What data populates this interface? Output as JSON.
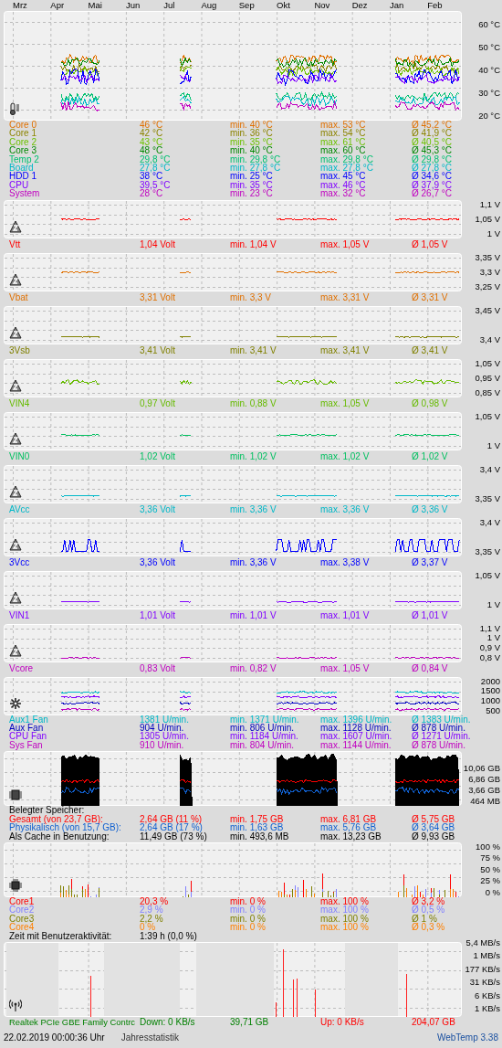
{
  "months": [
    "Mrz",
    "Apr",
    "Mai",
    "Jun",
    "Jul",
    "Aug",
    "Sep",
    "Okt",
    "Nov",
    "Dez",
    "Jan",
    "Feb"
  ],
  "panels": [
    {
      "kind": "temperature",
      "y_ticks": [
        "60 °C",
        "50 °C",
        "40 °C",
        "30 °C",
        "20 °C"
      ],
      "sensors": [
        {
          "name": "Core 0",
          "current": "46 °C",
          "min": "min. 40 °C",
          "max": "max. 53 °C",
          "avg": "Ø 45,2 °C",
          "color": "#e07000"
        },
        {
          "name": "Core 1",
          "current": "42 °C",
          "min": "min. 36 °C",
          "max": "max. 54 °C",
          "avg": "Ø 41,9 °C",
          "color": "#8c8400"
        },
        {
          "name": "Core 2",
          "current": "43 °C",
          "min": "min. 35 °C",
          "max": "max. 61 °C",
          "avg": "Ø 40,5 °C",
          "color": "#6cc000"
        },
        {
          "name": "Core 3",
          "current": "48 °C",
          "min": "min. 40 °C",
          "max": "max. 60 °C",
          "avg": "Ø 45,3 °C",
          "color": "#008800"
        },
        {
          "name": "Temp 2",
          "current": "29,8 °C",
          "min": "min. 29,8 °C",
          "max": "max. 29,8 °C",
          "avg": "Ø 29,8 °C",
          "color": "#00c070"
        },
        {
          "name": "Board",
          "current": "27,8 °C",
          "min": "min. 27,8 °C",
          "max": "max. 27,8 °C",
          "avg": "Ø 27,8 °C",
          "color": "#00b8c8"
        },
        {
          "name": "HDD 1",
          "current": "38 °C",
          "min": "min. 25 °C",
          "max": "max. 45 °C",
          "avg": "Ø 34,6 °C",
          "color": "#0000ff"
        },
        {
          "name": "CPU",
          "current": "39,5 °C",
          "min": "min. 35 °C",
          "max": "max. 46 °C",
          "avg": "Ø 37,9 °C",
          "color": "#8000ff"
        },
        {
          "name": "System",
          "current": "28 °C",
          "min": "min. 23 °C",
          "max": "max. 32 °C",
          "avg": "Ø 26,7 °C",
          "color": "#c000c0"
        }
      ]
    },
    {
      "kind": "voltage",
      "y_ticks": [
        "1,1 V",
        "1,05 V",
        "1 V"
      ],
      "sensors": [
        {
          "name": "Vtt",
          "current": "1,04 Volt",
          "min": "min. 1,04 V",
          "max": "max. 1,05 V",
          "avg": "Ø 1,05 V",
          "color": "#ff0000"
        }
      ]
    },
    {
      "kind": "voltage",
      "y_ticks": [
        "3,35 V",
        "3,3 V",
        "3,25 V"
      ],
      "sensors": [
        {
          "name": "Vbat",
          "current": "3,31 Volt",
          "min": "min. 3,3 V",
          "max": "max. 3,31 V",
          "avg": "Ø 3,31 V",
          "color": "#e07000"
        }
      ]
    },
    {
      "kind": "voltage",
      "y_ticks": [
        "3,45 V",
        "3,4 V"
      ],
      "sensors": [
        {
          "name": "3Vsb",
          "current": "3,41 Volt",
          "min": "min. 3,41 V",
          "max": "max. 3,41 V",
          "avg": "Ø 3,41 V",
          "color": "#808000"
        }
      ]
    },
    {
      "kind": "voltage",
      "y_ticks": [
        "1,05 V",
        "0,95 V",
        "0,85 V"
      ],
      "sensors": [
        {
          "name": "VIN4",
          "current": "0,97 Volt",
          "min": "min. 0,88 V",
          "max": "max. 1,05 V",
          "avg": "Ø 0,98 V",
          "color": "#66bb00"
        }
      ]
    },
    {
      "kind": "voltage",
      "y_ticks": [
        "1,05 V",
        "1 V"
      ],
      "sensors": [
        {
          "name": "VIN0",
          "current": "1,02 Volt",
          "min": "min. 1,02 V",
          "max": "max. 1,02 V",
          "avg": "Ø 1,02 V",
          "color": "#00c060"
        }
      ]
    },
    {
      "kind": "voltage",
      "y_ticks": [
        "3,4 V",
        "3,35 V"
      ],
      "sensors": [
        {
          "name": "AVcc",
          "current": "3,36 Volt",
          "min": "min. 3,36 V",
          "max": "max. 3,36 V",
          "avg": "Ø 3,36 V",
          "color": "#00b8c8"
        }
      ]
    },
    {
      "kind": "voltage",
      "y_ticks": [
        "3,4 V",
        "3,35 V"
      ],
      "sensors": [
        {
          "name": "3Vcc",
          "current": "3,36 Volt",
          "min": "min. 3,36 V",
          "max": "max. 3,38 V",
          "avg": "Ø 3,37 V",
          "color": "#0000ff"
        }
      ]
    },
    {
      "kind": "voltage",
      "y_ticks": [
        "1,05 V",
        "1 V"
      ],
      "sensors": [
        {
          "name": "VIN1",
          "current": "1,01 Volt",
          "min": "min. 1,01 V",
          "max": "max. 1,01 V",
          "avg": "Ø 1,01 V",
          "color": "#8000ff"
        }
      ]
    },
    {
      "kind": "voltage",
      "y_ticks": [
        "1,1 V",
        "1 V",
        "0,9 V",
        "0,8 V"
      ],
      "sensors": [
        {
          "name": "Vcore",
          "current": "0,83 Volt",
          "min": "min. 0,82 V",
          "max": "max. 1,05 V",
          "avg": "Ø 0,84 V",
          "color": "#c000c0"
        }
      ]
    },
    {
      "kind": "fan",
      "y_ticks": [
        "2000",
        "1500",
        "1000",
        "500"
      ],
      "sensors": [
        {
          "name": "Aux1 Fan",
          "current": "1381 U/min.",
          "min": "min. 1371 U/min.",
          "max": "max. 1396 U/min.",
          "avg": "Ø 1383 U/min.",
          "color": "#00b8c8"
        },
        {
          "name": "Aux Fan",
          "current": "904 U/min.",
          "min": "min. 806 U/min.",
          "max": "max. 1128 U/min.",
          "avg": "Ø 878 U/min.",
          "color": "#0000c0"
        },
        {
          "name": "CPU Fan",
          "current": "1305 U/min.",
          "min": "min. 1184 U/min.",
          "max": "max. 1607 U/min.",
          "avg": "Ø 1271 U/min.",
          "color": "#8000ff"
        },
        {
          "name": "Sys Fan",
          "current": "910 U/min.",
          "min": "min. 804 U/min.",
          "max": "max. 1144 U/min.",
          "avg": "Ø 878 U/min.",
          "color": "#c000c0"
        }
      ]
    },
    {
      "kind": "memory",
      "y_ticks": [
        "10,06 GB",
        "6,86 GB",
        "3,66 GB",
        "464 MB"
      ],
      "heading": "Belegter Speicher:",
      "sensors": [
        {
          "name": "Gesamt (von 23,7 GB):",
          "current": "2,64 GB (11 %)",
          "min": "min. 1,75 GB",
          "max": "max. 6,81 GB",
          "avg": "Ø 5,75 GB",
          "color": "#ff0000"
        },
        {
          "name": "Physikalisch (von 15,7 GB):",
          "current": "2,64 GB (17 %)",
          "min": "min. 1,63 GB",
          "max": "max. 5,76 GB",
          "avg": "Ø 3,64 GB",
          "color": "#1060d0"
        },
        {
          "name": "Als Cache in Benutzung:",
          "current": "11,49 GB (73 %)",
          "min": "min. 493,6 MB",
          "max": "max. 13,23 GB",
          "avg": "Ø 9,93 GB",
          "color": "#000000"
        }
      ]
    },
    {
      "kind": "cpu",
      "y_ticks": [
        "100 %",
        "75 %",
        "50 %",
        "25 %",
        "0 %"
      ],
      "sensors": [
        {
          "name": "Core1",
          "current": "20,3 %",
          "min": "min. 0 %",
          "max": "max. 100 %",
          "avg": "Ø 3,2 %",
          "color": "#ff0000"
        },
        {
          "name": "Core2",
          "current": "2,9 %",
          "min": "min. 0 %",
          "max": "max. 100 %",
          "avg": "Ø 0,5 %",
          "color": "#8080ff"
        },
        {
          "name": "Core3",
          "current": "2,2 %",
          "min": "min. 0 %",
          "max": "max. 100 %",
          "avg": "Ø 1 %",
          "color": "#808000"
        },
        {
          "name": "Core4",
          "current": "0 %",
          "min": "min. 0 %",
          "max": "max. 100 %",
          "avg": "Ø 0,3 %",
          "color": "#ff8000"
        }
      ],
      "activity": {
        "label": "Zeit mit Benutzeraktivität:",
        "value": "1:39 h (0,0 %)"
      }
    },
    {
      "kind": "network",
      "y_ticks": [
        "5,4 MB/s",
        "1 MB/s",
        "177 KB/s",
        "31 KB/s",
        "6 KB/s",
        "1 KB/s"
      ],
      "adapter": {
        "name": "Realtek PCIe GBE Family Contrc",
        "down": "Down: 0 KB/s",
        "down_total": "39,71 GB",
        "up": "Up: 0 KB/s",
        "up_total": "204,07 GB"
      }
    }
  ],
  "footer": {
    "timestamp": "22.02.2019 00:00:36 Uhr",
    "view": "Jahresstatistik",
    "version": "WebTemp 3.38"
  }
}
